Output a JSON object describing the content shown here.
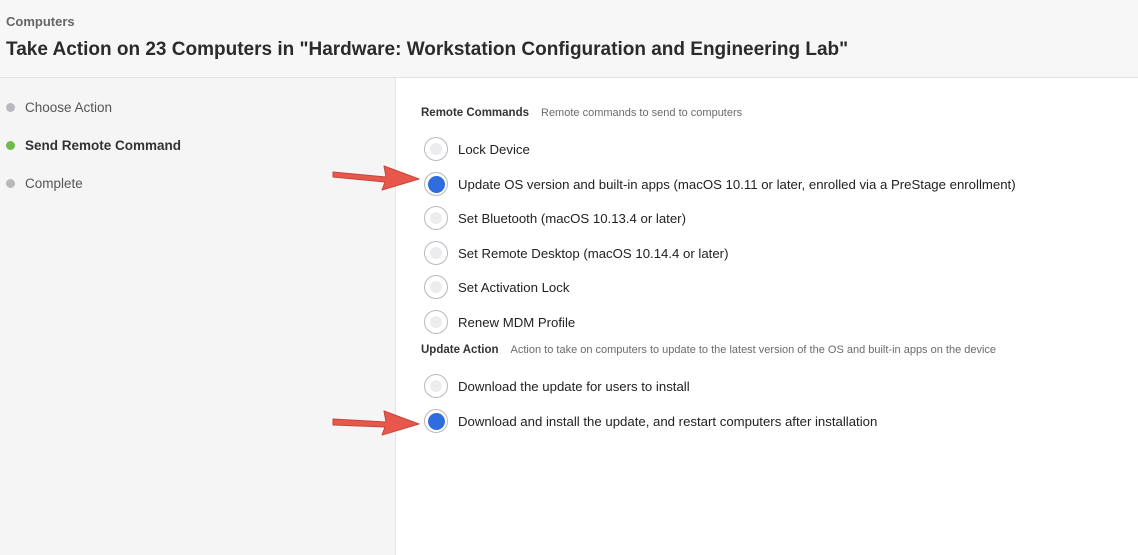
{
  "header": {
    "breadcrumb": "Computers",
    "title": "Take Action on 23 Computers in \"Hardware: Workstation Configuration and Engineering Lab\""
  },
  "steps": [
    {
      "label": "Choose Action",
      "state": "done"
    },
    {
      "label": "Send Remote Command",
      "state": "current"
    },
    {
      "label": "Complete",
      "state": "pending"
    }
  ],
  "remote_commands": {
    "label": "Remote Commands",
    "description": "Remote commands to send to computers",
    "options": [
      {
        "label": "Lock Device",
        "selected": false
      },
      {
        "label": "Update OS version and built-in apps (macOS 10.11 or later, enrolled via a PreStage enrollment)",
        "selected": true
      },
      {
        "label": "Set Bluetooth (macOS 10.13.4 or later)",
        "selected": false
      },
      {
        "label": "Set Remote Desktop (macOS 10.14.4 or later)",
        "selected": false
      },
      {
        "label": "Set Activation Lock",
        "selected": false
      },
      {
        "label": "Renew MDM Profile",
        "selected": false
      }
    ]
  },
  "update_action": {
    "label": "Update Action",
    "description": "Action to take on computers to update to the latest version of the OS and built-in apps on the device",
    "options": [
      {
        "label": "Download the update for users to install",
        "selected": false
      },
      {
        "label": "Download and install the update, and restart computers after installation",
        "selected": true
      }
    ]
  },
  "colors": {
    "accent": "#2f6ce0",
    "step_active": "#6fba4a",
    "annotation_arrow": "#e8574b"
  }
}
